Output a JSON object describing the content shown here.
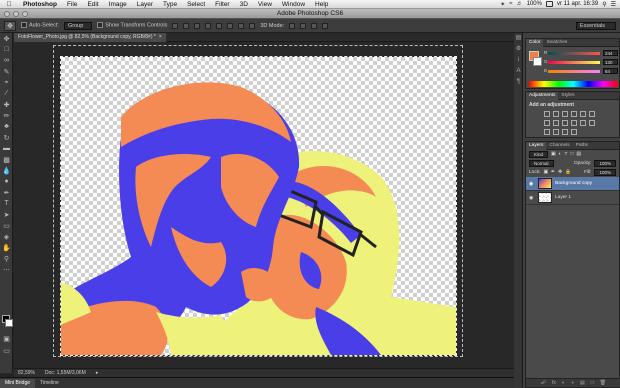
{
  "menubar": {
    "app": "Photoshop",
    "menus": [
      "File",
      "Edit",
      "Image",
      "Layer",
      "Type",
      "Select",
      "Filter",
      "3D",
      "View",
      "Window",
      "Help"
    ],
    "battery": "100%",
    "clock": "vr 11 apr.  16:39"
  },
  "window": {
    "title": "Adobe Photoshop CS6"
  },
  "options": {
    "auto_select": "Auto-Select:",
    "auto_select_value": "Group",
    "show_transform": "Show Transform Controls",
    "mode3d": "3D Mode:",
    "workspace": "Essentials"
  },
  "document": {
    "tab": "FotoFlower_Photo.jpg @ 82,5% (Background copy, RGB/8#) *",
    "zoom": "82,59%",
    "doc_size": "Doc: 1,55M/3,06M"
  },
  "bottom_tabs": [
    "Mini Bridge",
    "Timeline"
  ],
  "color_panel": {
    "tabs": [
      "Color",
      "Swatches"
    ],
    "sliders": [
      {
        "label": "R",
        "value": "244"
      },
      {
        "label": "G",
        "value": "130"
      },
      {
        "label": "B",
        "value": "84"
      }
    ]
  },
  "adjustments_panel": {
    "tabs": [
      "Adjustments",
      "Styles"
    ],
    "heading": "Add an adjustment"
  },
  "layers_panel": {
    "tabs": [
      "Layers",
      "Channels",
      "Paths"
    ],
    "kind": "Kind",
    "blend": "Normal",
    "opacity_label": "Opacity:",
    "opacity": "100%",
    "lock_label": "Lock:",
    "fill_label": "Fill:",
    "fill": "100%",
    "layers": [
      {
        "name": "Background copy",
        "selected": true,
        "visible": true
      },
      {
        "name": "Layer 1",
        "selected": false,
        "visible": true
      }
    ]
  },
  "colors": {
    "orange": "#f48a54",
    "blue": "#4a3ee8",
    "yellow": "#eef27a",
    "selection": "#5878a8"
  }
}
